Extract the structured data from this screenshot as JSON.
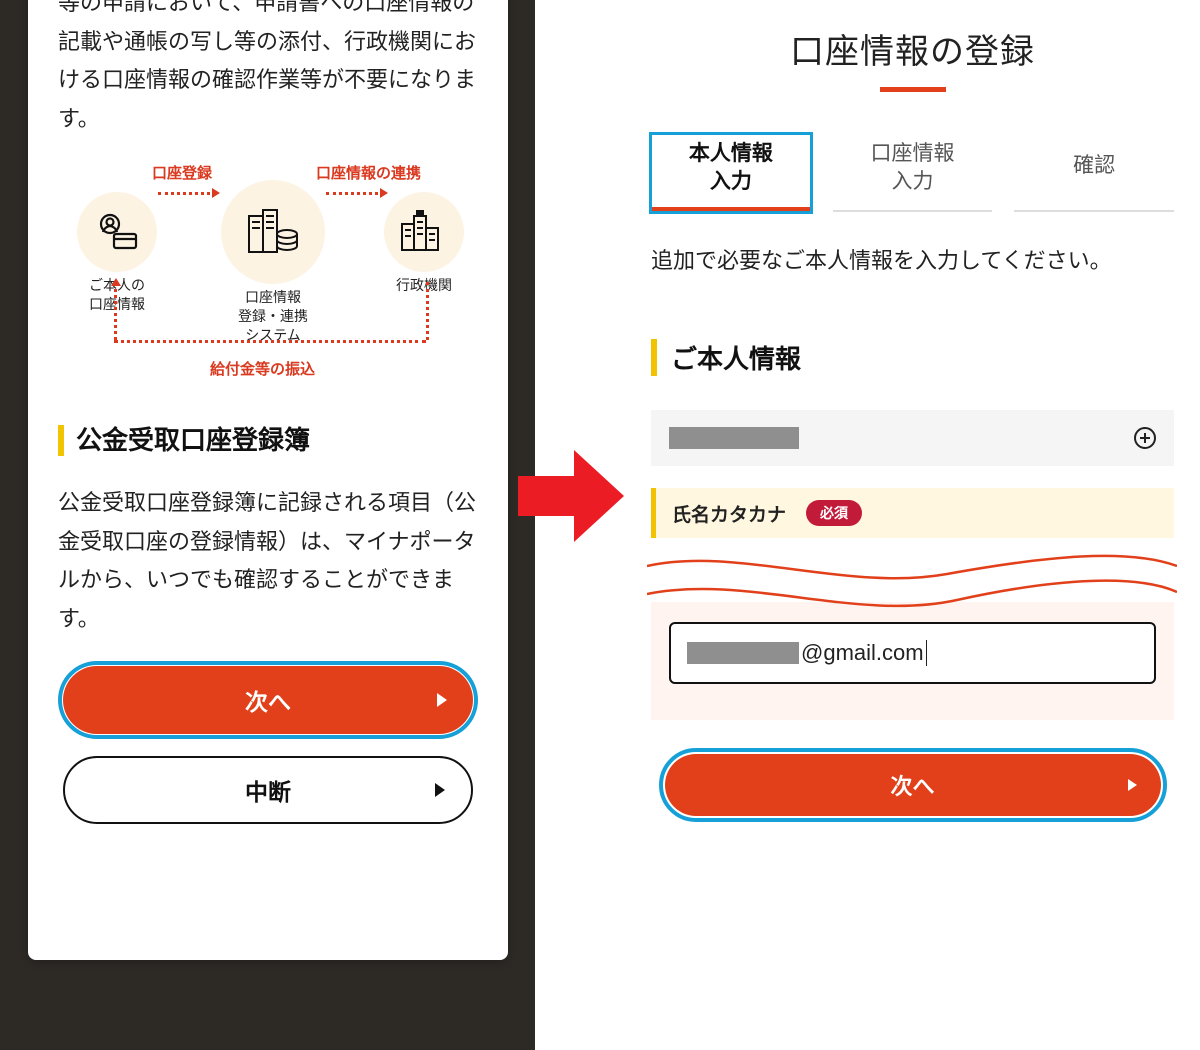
{
  "left": {
    "intro": "等の申請において、申請書への口座情報の記載や通帳の写し等の添付、行政機関における口座情報の確認作業等が不要になります。",
    "diagram": {
      "top_left": "口座登録",
      "top_right": "口座情報の連携",
      "node_left_l1": "ご本人の",
      "node_left_l2": "口座情報",
      "node_center_l1": "口座情報",
      "node_center_l2": "登録・連携",
      "node_center_l3": "システム",
      "node_right": "行政機関",
      "bottom": "給付金等の振込"
    },
    "section_heading": "公金受取口座登録簿",
    "section_body": "公金受取口座登録簿に記録される項目（公金受取口座の登録情報）は、マイナポータルから、いつでも確認することができます。",
    "btn_primary": "次へ",
    "btn_secondary": "中断"
  },
  "right": {
    "title": "口座情報の登録",
    "tabs": {
      "t1_l1": "本人情報",
      "t1_l2": "入力",
      "t2_l1": "口座情報",
      "t2_l2": "入力",
      "t3": "確認"
    },
    "instruction": "追加で必要なご本人情報を入力してください。",
    "section_heading": "ご本人情報",
    "field_label": "氏名カタカナ",
    "required_badge": "必須",
    "email_suffix": "@gmail.com",
    "btn_next": "次へ"
  }
}
